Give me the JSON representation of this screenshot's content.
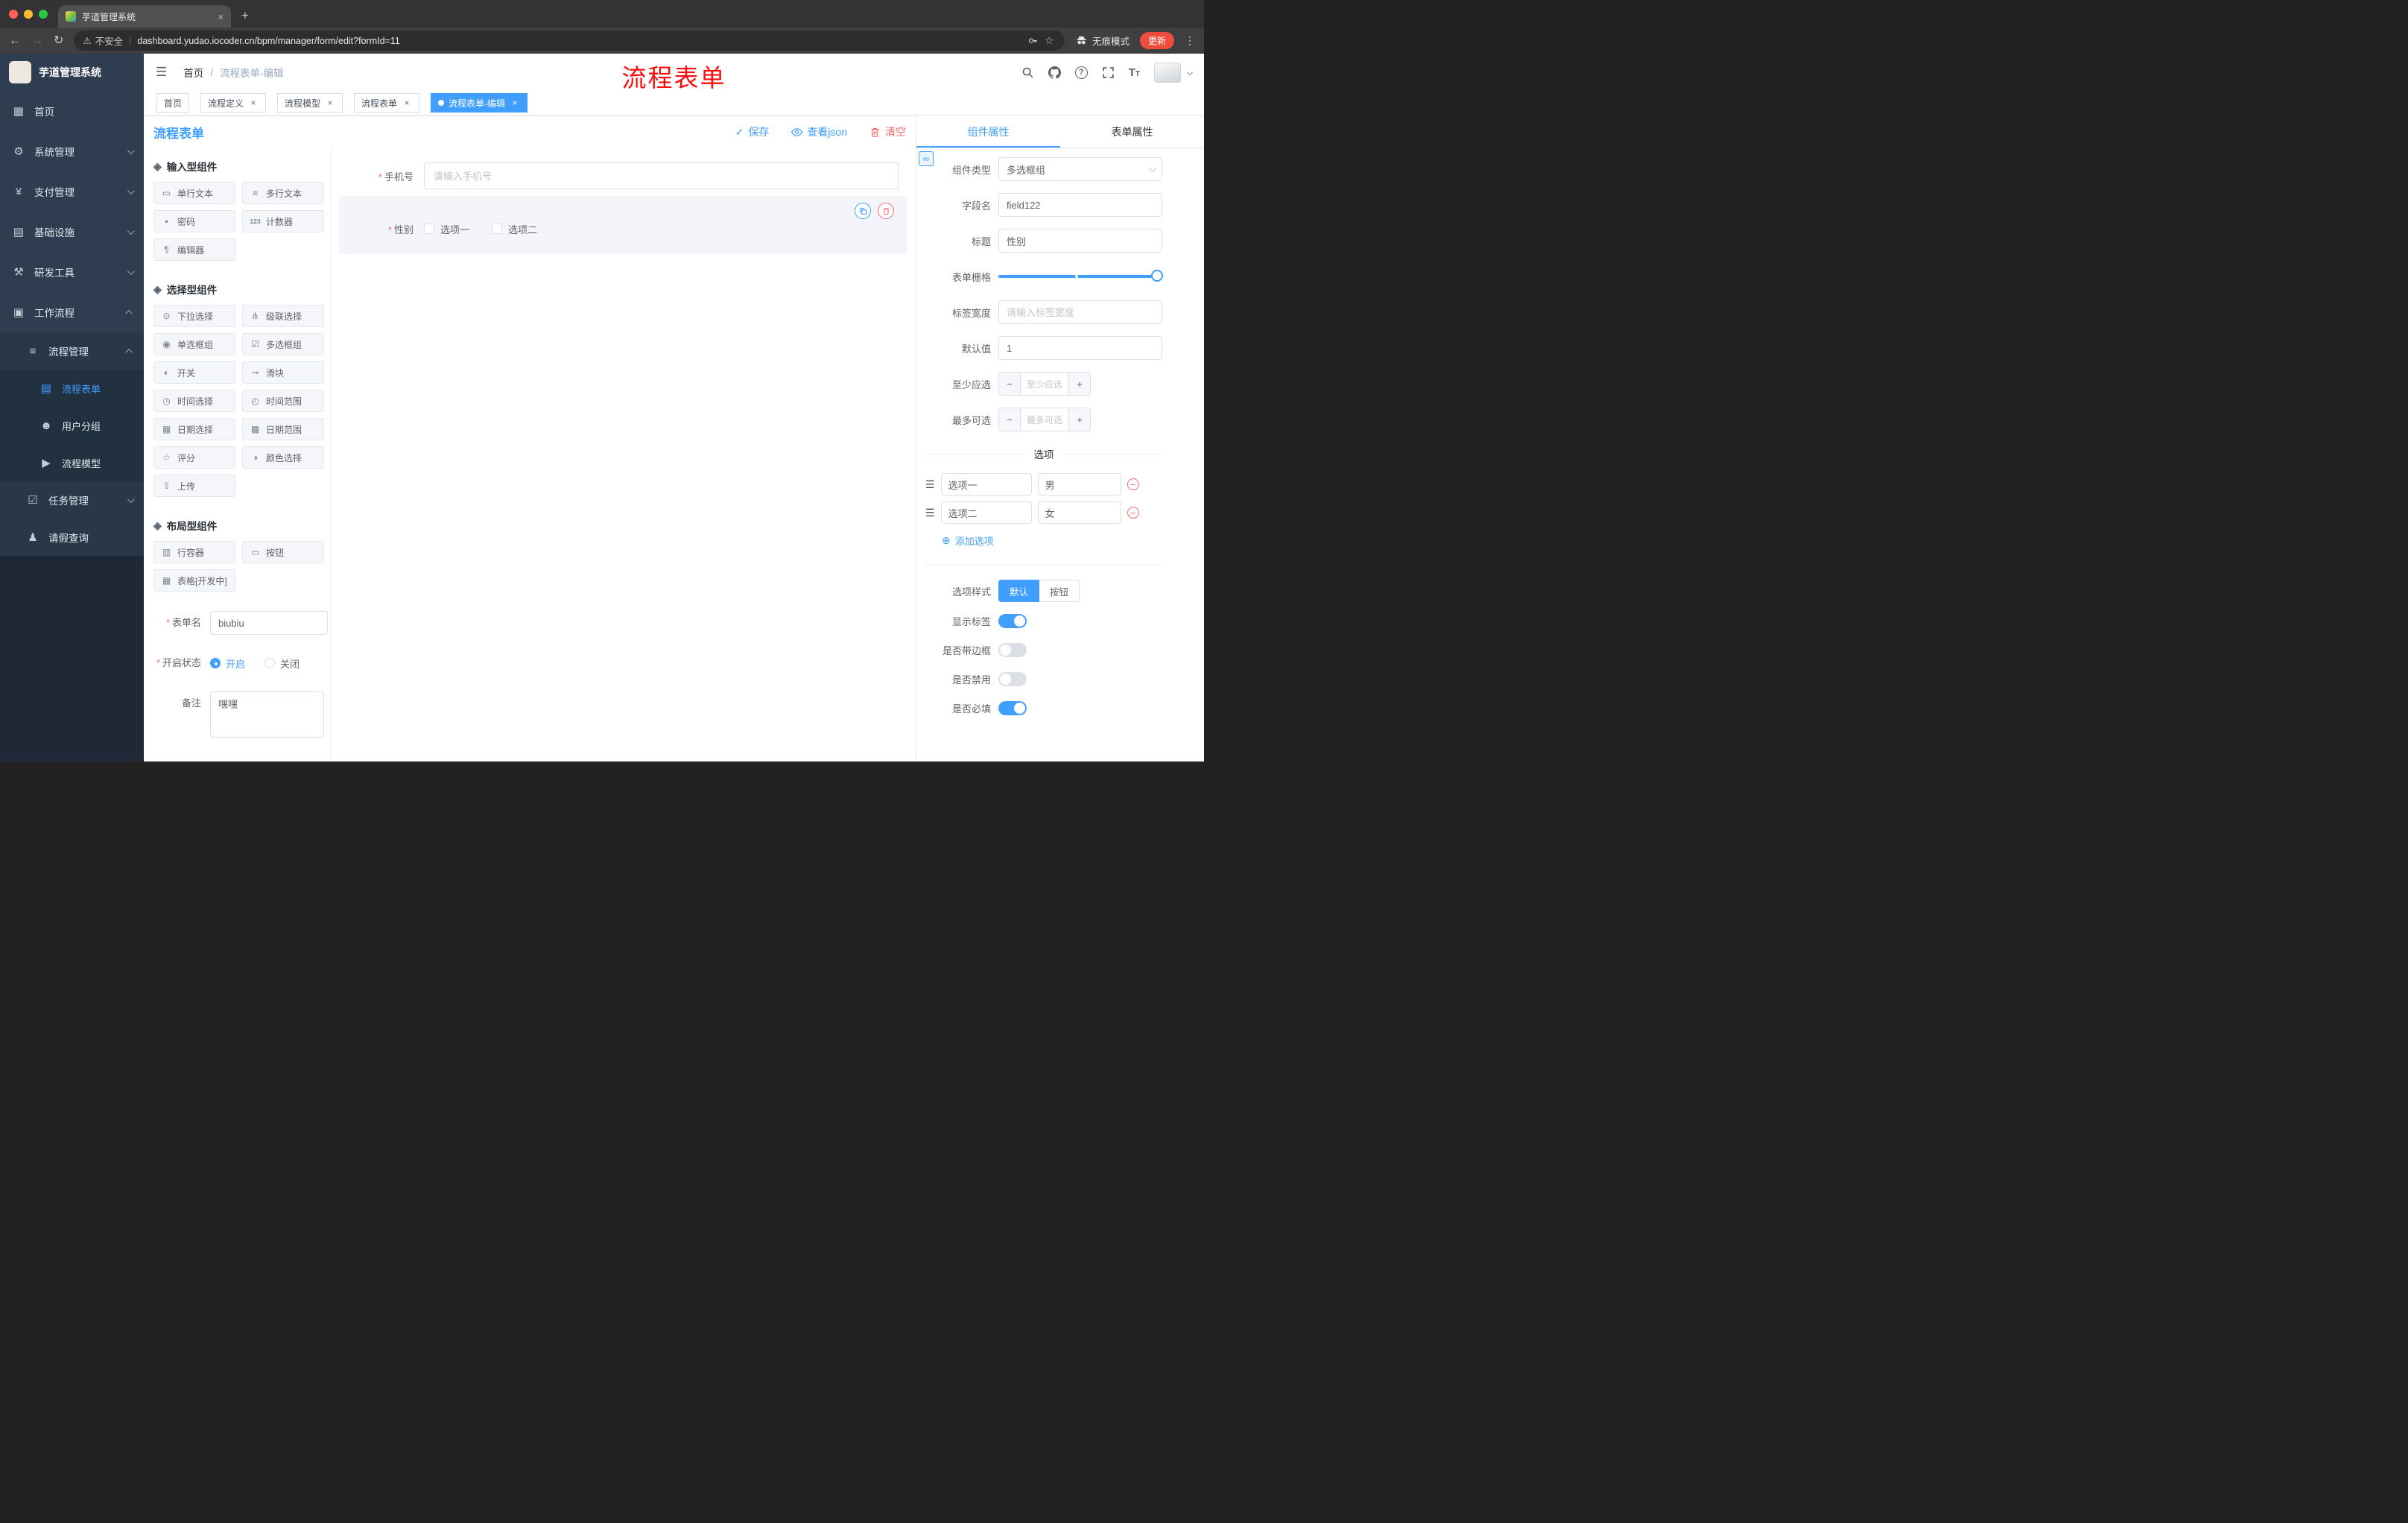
{
  "browser": {
    "tab_title": "芋道管理系统",
    "security_label": "不安全",
    "url": "dashboard.yudao.iocoder.cn/bpm/manager/form/edit?formId=11",
    "incognito_label": "无痕模式",
    "update_label": "更新"
  },
  "annotation": "流程表单",
  "sidebar": {
    "logo_title": "芋道管理系统",
    "items": [
      {
        "label": "首页"
      },
      {
        "label": "系统管理"
      },
      {
        "label": "支付管理"
      },
      {
        "label": "基础设施"
      },
      {
        "label": "研发工具"
      },
      {
        "label": "工作流程"
      },
      {
        "label": "流程管理"
      },
      {
        "label": "流程表单"
      },
      {
        "label": "用户分组"
      },
      {
        "label": "流程模型"
      },
      {
        "label": "任务管理"
      },
      {
        "label": "请假查询"
      }
    ]
  },
  "header": {
    "breadcrumb": [
      "首页",
      "流程表单-编辑"
    ]
  },
  "tags": [
    {
      "label": "首页"
    },
    {
      "label": "流程定义"
    },
    {
      "label": "流程模型"
    },
    {
      "label": "流程表单"
    },
    {
      "label": "流程表单-编辑"
    }
  ],
  "toolbar": {
    "title": "流程表单",
    "save": "保存",
    "view_json": "查看json",
    "clear": "清空"
  },
  "palette": {
    "sections": [
      {
        "title": "输入型组件",
        "items": [
          "单行文本",
          "多行文本",
          "密码",
          "计数器",
          "编辑器"
        ]
      },
      {
        "title": "选择型组件",
        "items": [
          "下拉选择",
          "级联选择",
          "单选框组",
          "多选框组",
          "开关",
          "滑块",
          "时间选择",
          "时间范围",
          "日期选择",
          "日期范围",
          "评分",
          "颜色选择",
          "上传"
        ]
      },
      {
        "title": "布局型组件",
        "items": [
          "行容器",
          "按钮",
          "表格[开发中]"
        ]
      }
    ]
  },
  "form_settings": {
    "name_label": "表单名",
    "name_value": "biubiu",
    "status_label": "开启状态",
    "status_on": "开启",
    "status_off": "关闭",
    "remark_label": "备注",
    "remark_value": "嘿嘿"
  },
  "canvas": {
    "phone_label": "手机号",
    "phone_placeholder": "请输入手机号",
    "gender_label": "性别",
    "gender_option1": "选项一",
    "gender_option2": "选项二"
  },
  "panel": {
    "tab_component": "组件属性",
    "tab_form": "表单属性",
    "component_type_label": "组件类型",
    "component_type_value": "多选框组",
    "field_name_label": "字段名",
    "field_name_value": "field122",
    "title_label": "标题",
    "title_value": "性别",
    "grid_label": "表单栅格",
    "label_width_label": "标签宽度",
    "label_width_placeholder": "请输入标签宽度",
    "default_label": "默认值",
    "default_value": "1",
    "min_label": "至少应选",
    "min_placeholder": "至少应选",
    "max_label": "最多可选",
    "max_placeholder": "最多可选",
    "options_title": "选项",
    "options": [
      {
        "name": "选项一",
        "value": "男"
      },
      {
        "name": "选项二",
        "value": "女"
      }
    ],
    "add_option": "添加选项",
    "style_label": "选项样式",
    "style_default": "默认",
    "style_button": "按钮",
    "toggle_show_label": "显示标签",
    "toggle_border": "是否带边框",
    "toggle_disabled": "是否禁用",
    "toggle_required": "是否必填"
  },
  "colors": {
    "accent": "#409eff",
    "danger": "#f56c6c",
    "annotation_red": "#fd0d0d"
  }
}
